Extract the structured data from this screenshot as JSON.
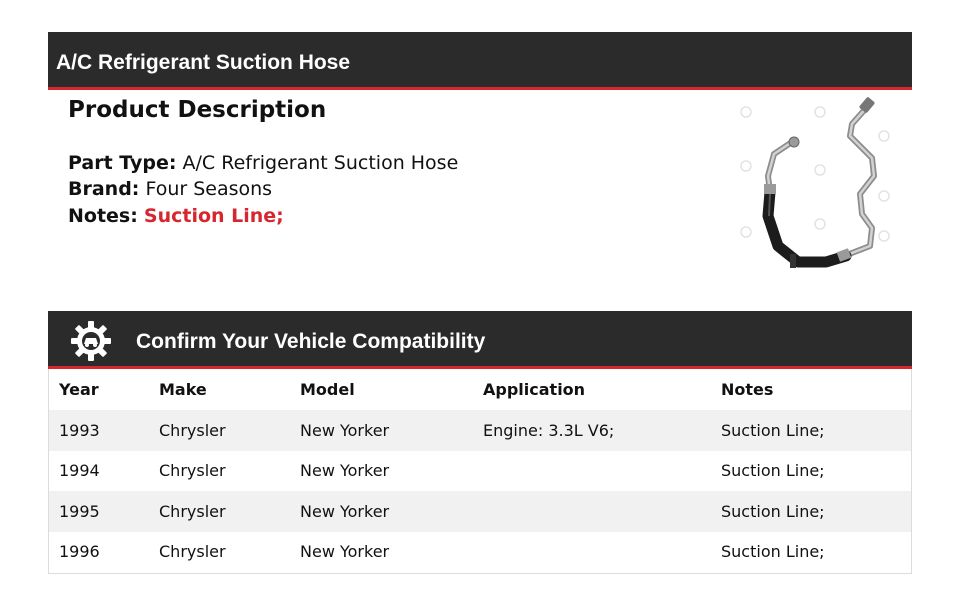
{
  "header": {
    "title": "A/C Refrigerant Suction Hose"
  },
  "description": {
    "title": "Product Description",
    "part_type_label": "Part Type:",
    "part_type": "A/C Refrigerant Suction Hose",
    "brand_label": "Brand:",
    "brand": "Four Seasons",
    "notes_label": "Notes:",
    "notes": "Suction Line;"
  },
  "compat": {
    "title": "Confirm Your Vehicle Compatibility",
    "columns": [
      "Year",
      "Make",
      "Model",
      "Application",
      "Notes"
    ],
    "rows": [
      [
        "1993",
        "Chrysler",
        "New Yorker",
        "Engine: 3.3L V6;",
        "Suction Line;"
      ],
      [
        "1994",
        "Chrysler",
        "New Yorker",
        "",
        "Suction Line;"
      ],
      [
        "1995",
        "Chrysler",
        "New Yorker",
        "",
        "Suction Line;"
      ],
      [
        "1996",
        "Chrysler",
        "New Yorker",
        "",
        "Suction Line;"
      ]
    ]
  },
  "colors": {
    "banner_bg": "#2c2b2b",
    "accent": "#d6262e",
    "row_alt": "#f1f1f1"
  },
  "icons": {
    "compat_icon": "gear-car-icon",
    "product_image": "suction-hose-image"
  }
}
